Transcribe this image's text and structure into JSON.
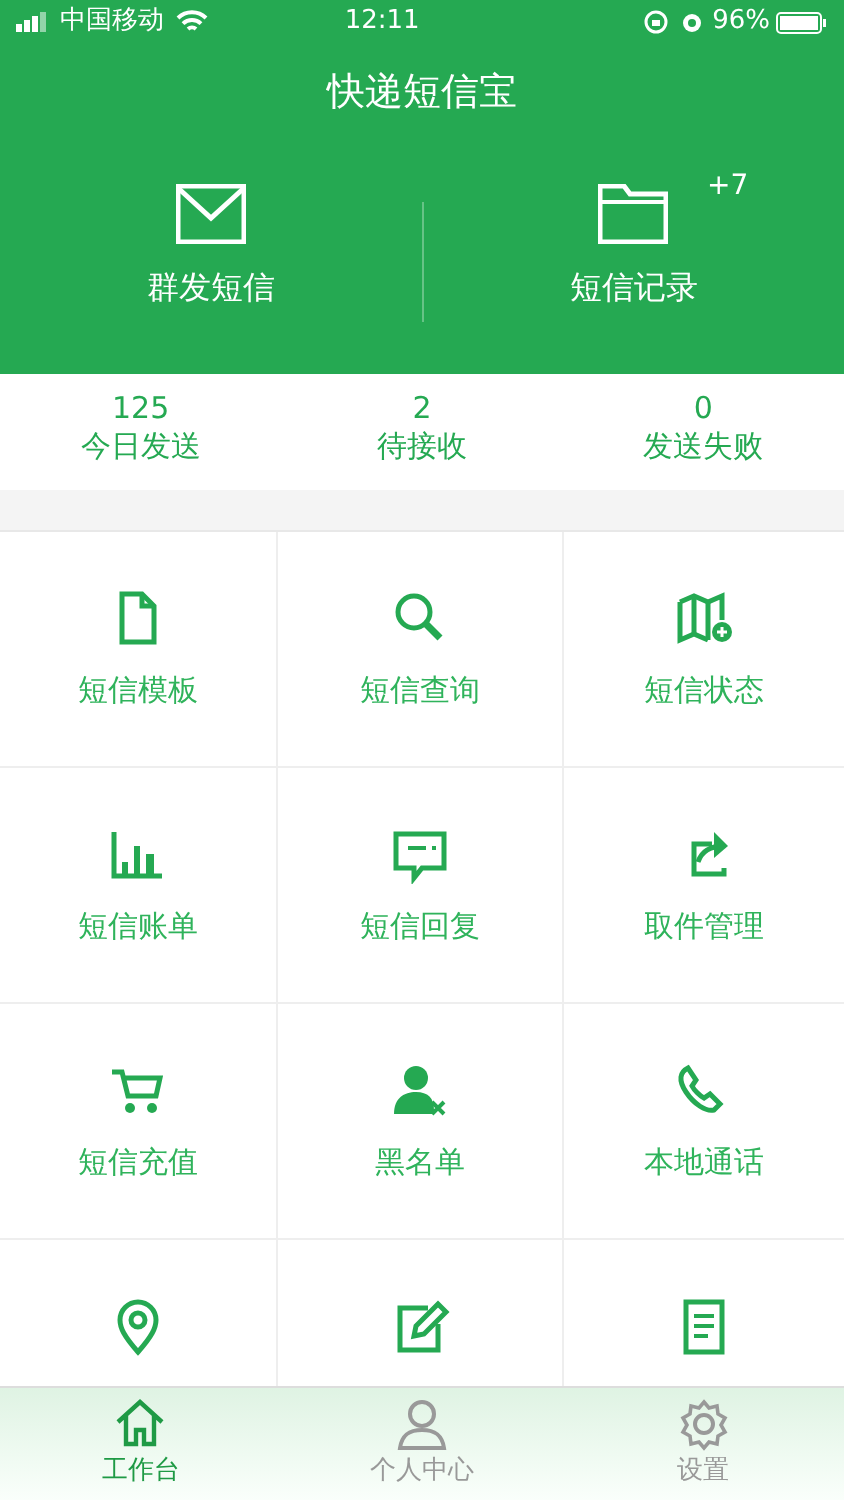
{
  "status_bar": {
    "carrier": "中国移动",
    "time": "12:11",
    "battery": "96%"
  },
  "header": {
    "title": "快递短信宝",
    "actions": [
      {
        "label": "群发短信"
      },
      {
        "label": "短信记录",
        "badge": "+7"
      }
    ]
  },
  "stats": [
    {
      "value": "125",
      "label": "今日发送"
    },
    {
      "value": "2",
      "label": "待接收"
    },
    {
      "value": "0",
      "label": "发送失败"
    }
  ],
  "grid": [
    {
      "label": "短信模板"
    },
    {
      "label": "短信查询"
    },
    {
      "label": "短信状态"
    },
    {
      "label": "短信账单"
    },
    {
      "label": "短信回复"
    },
    {
      "label": "取件管理"
    },
    {
      "label": "短信充值"
    },
    {
      "label": "黑名单"
    },
    {
      "label": "本地通话"
    },
    {
      "kind": "cut_off"
    },
    {
      "kind": "cut_off"
    },
    {
      "kind": "cut_off"
    }
  ],
  "tab_bar": [
    {
      "label": "工作台",
      "selected": true
    },
    {
      "label": "个人中心",
      "selected": false
    },
    {
      "label": "设置",
      "selected": false
    }
  ]
}
